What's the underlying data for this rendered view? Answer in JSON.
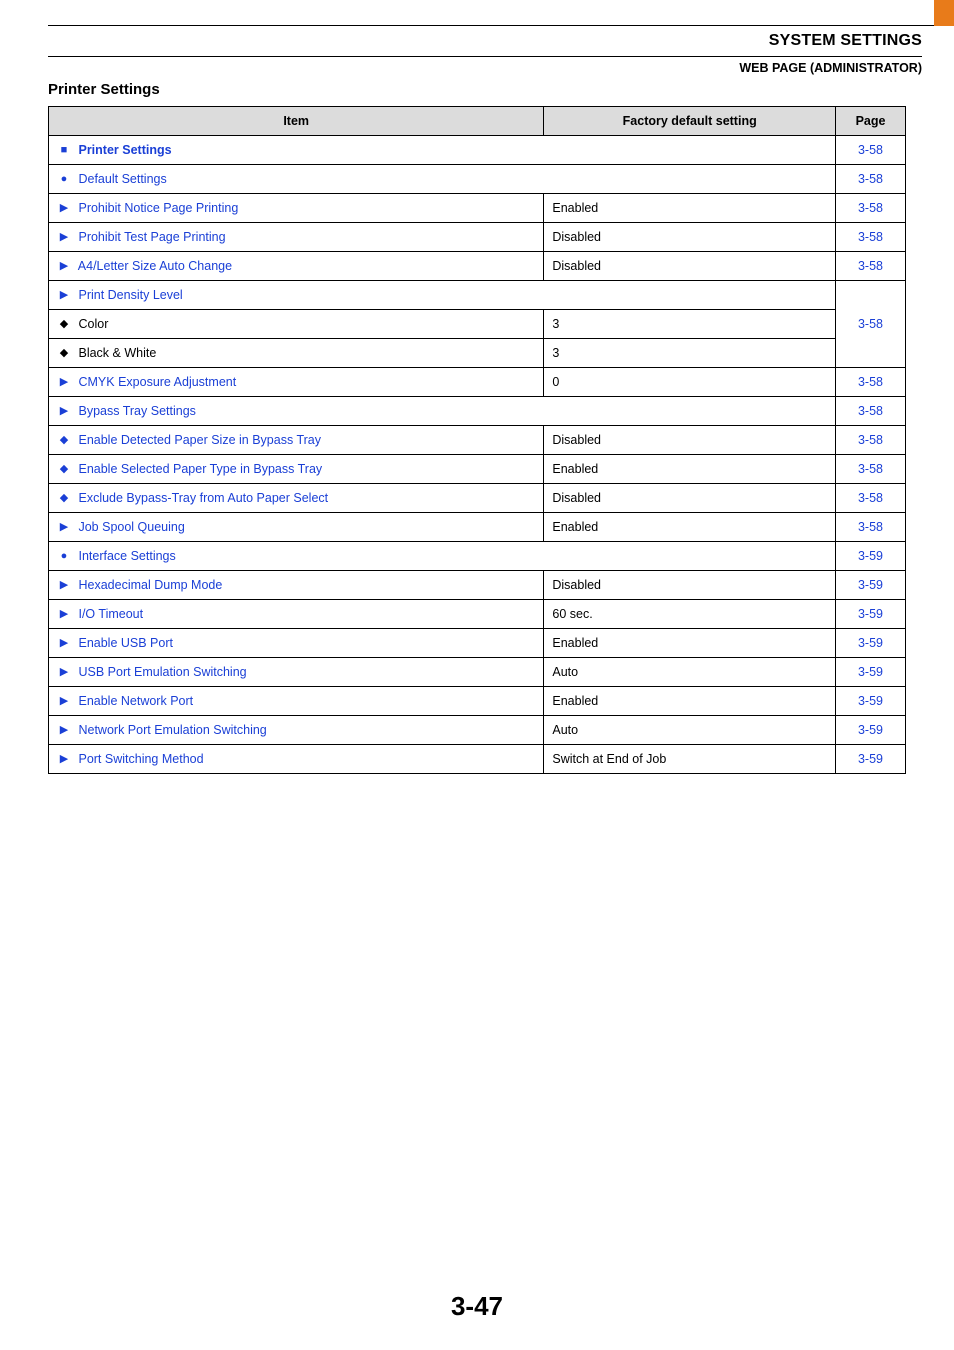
{
  "header": {
    "section_title": "SYSTEM SETTINGS",
    "subsection": "WEB PAGE (ADMINISTRATOR)"
  },
  "heading": "Printer Settings",
  "columns": {
    "item": "Item",
    "default": "Factory default setting",
    "page": "Page"
  },
  "rows": {
    "r0": {
      "item": "Printer Settings",
      "page": "3-58"
    },
    "r1": {
      "item": "Default Settings",
      "page": "3-58"
    },
    "r2": {
      "item": "Prohibit Notice Page Printing",
      "default": "Enabled",
      "page": "3-58"
    },
    "r3": {
      "item": "Prohibit Test Page Printing",
      "default": "Disabled",
      "page": "3-58"
    },
    "r4": {
      "item": "A4/Letter Size Auto Change",
      "default": "Disabled",
      "page": "3-58"
    },
    "r5": {
      "item": "Print Density Level"
    },
    "r6": {
      "item": "Color",
      "default": "3",
      "page": "3-58"
    },
    "r7": {
      "item": "Black & White",
      "default": "3"
    },
    "r8": {
      "item": "CMYK Exposure Adjustment",
      "default": "0",
      "page": "3-58"
    },
    "r9": {
      "item": "Bypass Tray Settings",
      "page": "3-58"
    },
    "r10": {
      "item": "Enable Detected Paper Size in Bypass Tray",
      "default": "Disabled",
      "page": "3-58"
    },
    "r11": {
      "item": "Enable Selected Paper Type in Bypass Tray",
      "default": "Enabled",
      "page": "3-58"
    },
    "r12": {
      "item": "Exclude Bypass-Tray from Auto Paper Select",
      "default": "Disabled",
      "page": "3-58"
    },
    "r13": {
      "item": "Job Spool Queuing",
      "default": "Enabled",
      "page": "3-58"
    },
    "r14": {
      "item": "Interface Settings",
      "page": "3-59"
    },
    "r15": {
      "item": "Hexadecimal Dump Mode",
      "default": "Disabled",
      "page": "3-59"
    },
    "r16": {
      "item": "I/O Timeout",
      "default": "60 sec.",
      "page": "3-59"
    },
    "r17": {
      "item": "Enable USB Port",
      "default": "Enabled",
      "page": "3-59"
    },
    "r18": {
      "item": "USB Port Emulation Switching",
      "default": "Auto",
      "page": "3-59"
    },
    "r19": {
      "item": "Enable Network Port",
      "default": "Enabled",
      "page": "3-59"
    },
    "r20": {
      "item": "Network Port Emulation Switching",
      "default": "Auto",
      "page": "3-59"
    },
    "r21": {
      "item": "Port Switching Method",
      "default": "Switch at End of Job",
      "page": "3-59"
    }
  },
  "page_number": "3-47"
}
